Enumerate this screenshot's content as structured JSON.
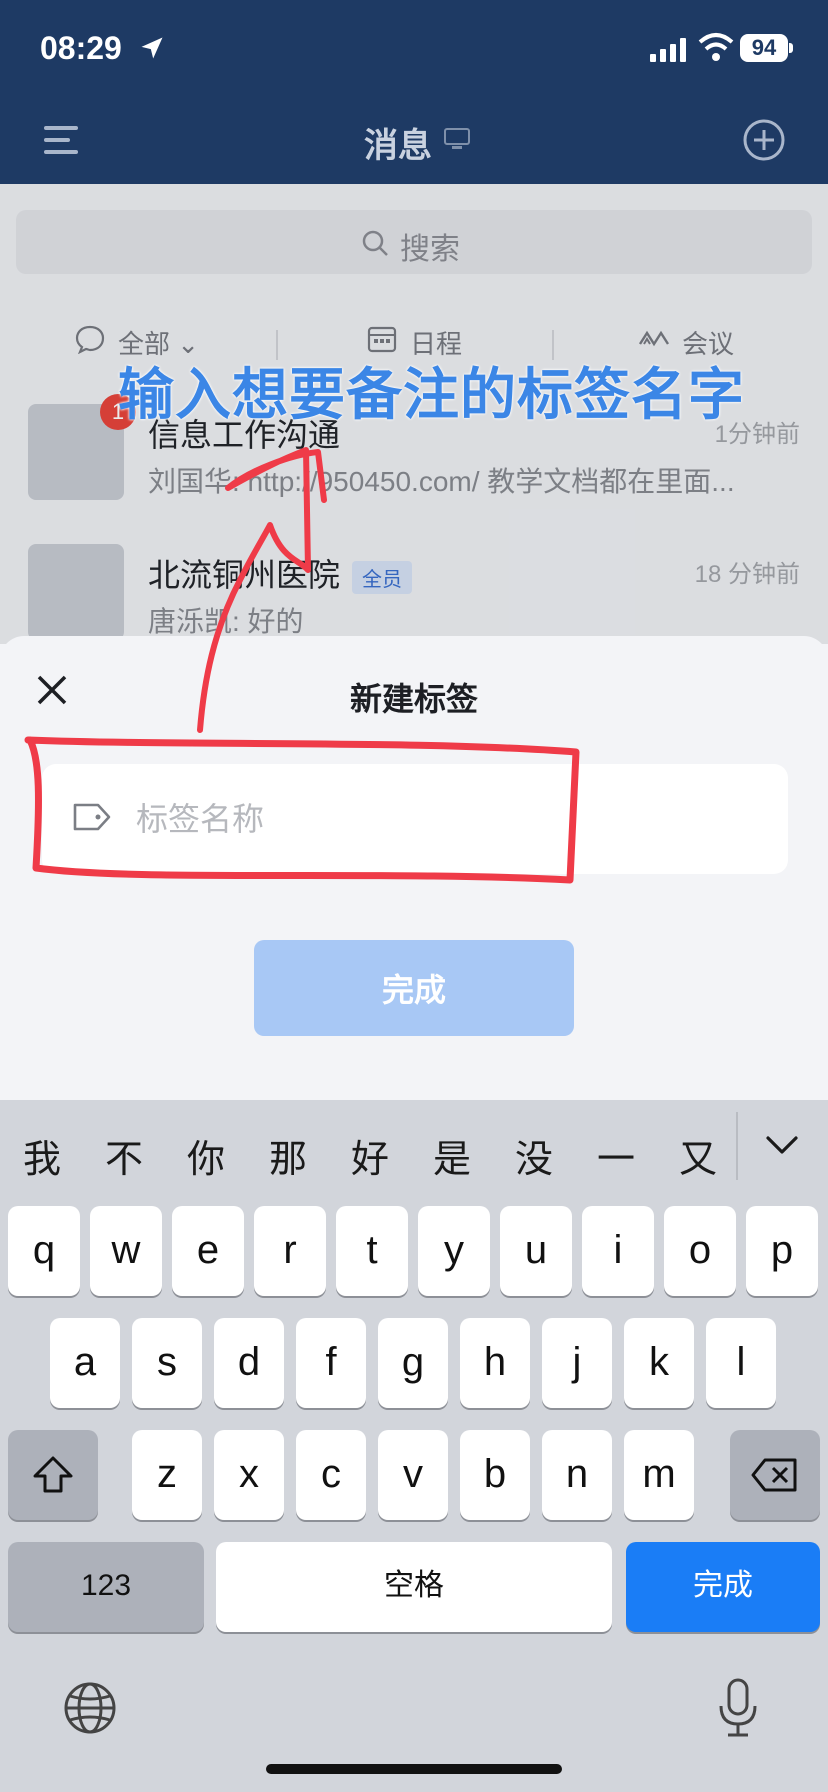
{
  "status_bar": {
    "time": "08:29",
    "battery": "94"
  },
  "header": {
    "title": "消息"
  },
  "search": {
    "placeholder": "搜索"
  },
  "filters": [
    {
      "label": "全部",
      "icon": "chat-bubble-icon"
    },
    {
      "label": "日程",
      "icon": "calendar-icon"
    },
    {
      "label": "会议",
      "icon": "meeting-icon"
    }
  ],
  "chats": [
    {
      "name": "信息工作沟通",
      "time": "1分钟前",
      "preview": "刘国华: http://950450.com/ 教学文档都在里面...",
      "badge": "1",
      "tag": ""
    },
    {
      "name": "北流铜州医院",
      "time": "18 分钟前",
      "preview": "唐泺凯: 好的",
      "badge": "",
      "tag": "全员"
    }
  ],
  "sheet": {
    "title": "新建标签",
    "input_placeholder": "标签名称",
    "done_label": "完成"
  },
  "annotation": {
    "text": "输入想要备注的标签名字",
    "color": "#3b86e6",
    "stroke_color": "#ef3b48"
  },
  "keyboard": {
    "candidates": [
      "我",
      "不",
      "你",
      "那",
      "好",
      "是",
      "没",
      "一",
      "又"
    ],
    "row1": [
      "q",
      "w",
      "e",
      "r",
      "t",
      "y",
      "u",
      "i",
      "o",
      "p"
    ],
    "row2": [
      "a",
      "s",
      "d",
      "f",
      "g",
      "h",
      "j",
      "k",
      "l"
    ],
    "row3": [
      "z",
      "x",
      "c",
      "v",
      "b",
      "n",
      "m"
    ],
    "numbers_label": "123",
    "space_label": "空格",
    "return_label": "完成"
  },
  "colors": {
    "header_bg": "#1e3a64",
    "accent": "#1a7df6",
    "done_disabled": "#a8c8f5"
  }
}
